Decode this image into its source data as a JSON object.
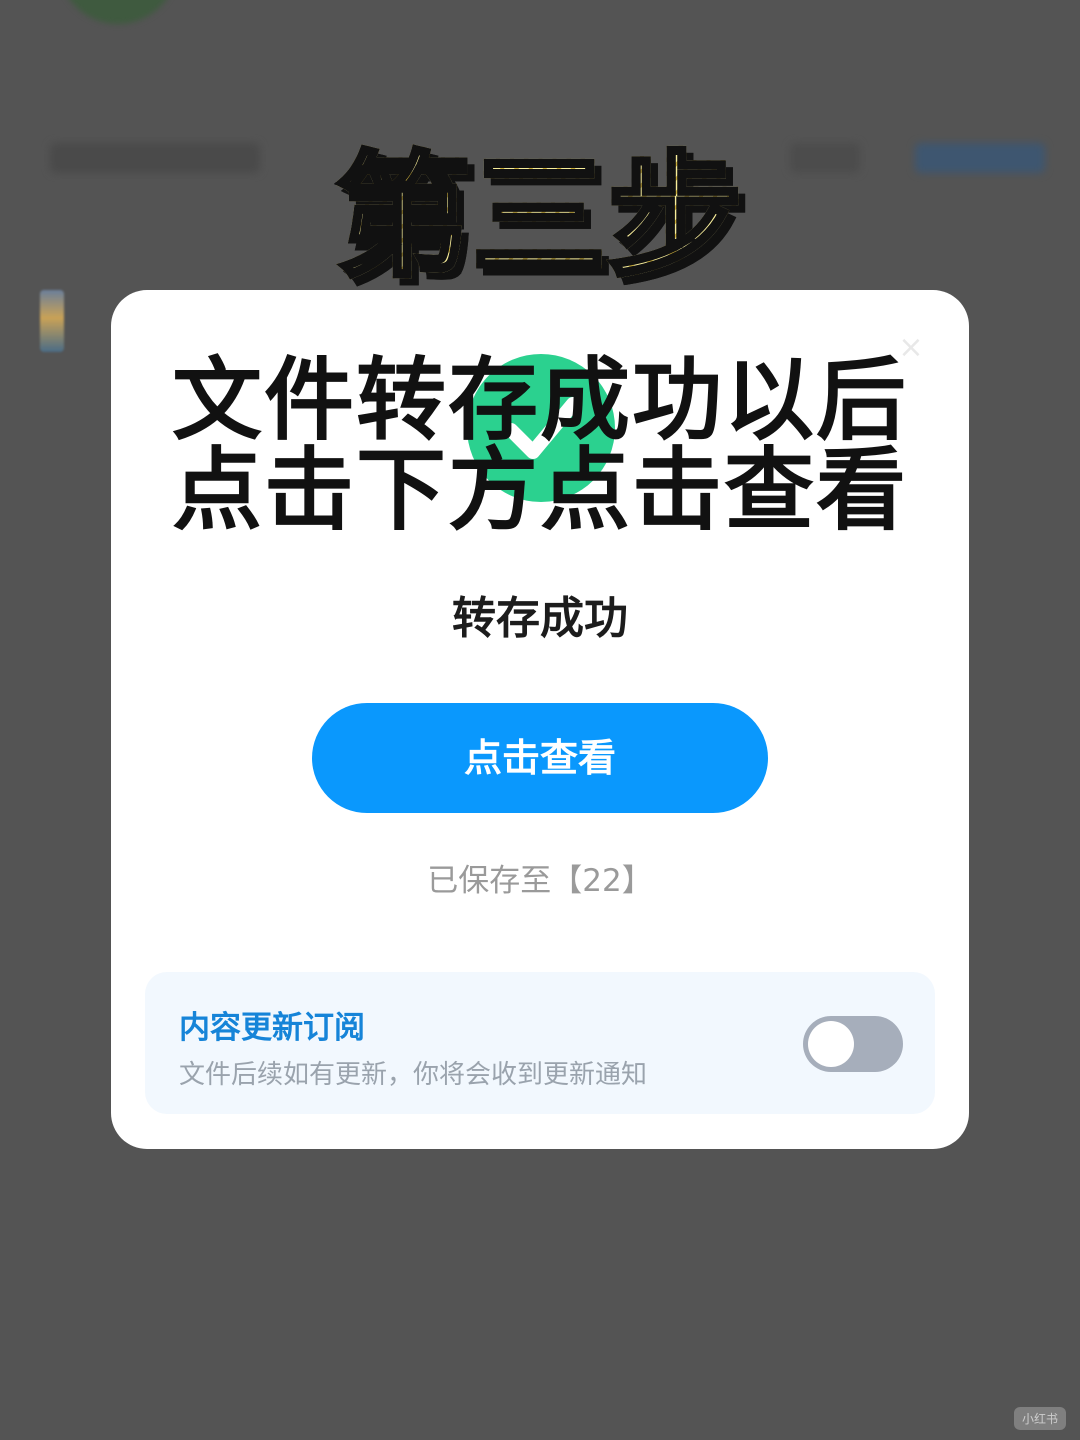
{
  "step_banner": "第三步",
  "instruction": {
    "line1": "文件转存成功以后",
    "line2": "点击下方点击查看"
  },
  "dialog": {
    "title": "转存成功",
    "view_button_label": "点击查看",
    "saved_to": "已保存至【22】",
    "close_icon": "×",
    "subscribe": {
      "title": "内容更新订阅",
      "description": "文件后续如有更新，你将会收到更新通知",
      "toggle_state": "off"
    }
  },
  "watermark": "小红书",
  "colors": {
    "accent": "#0a98fd",
    "success": "#2bd18f",
    "subscribe_title": "#1684d8",
    "banner": "#f7e88a"
  }
}
